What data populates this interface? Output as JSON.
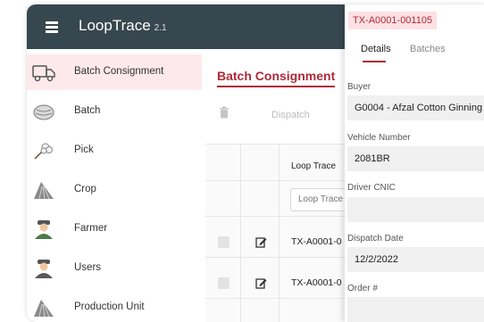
{
  "header": {
    "app_title": "LoopTrace",
    "version": "2.1"
  },
  "sidebar": {
    "items": [
      {
        "label": "Batch Consignment",
        "icon": "truck-icon"
      },
      {
        "label": "Batch",
        "icon": "cotton-bale-icon"
      },
      {
        "label": "Pick",
        "icon": "cotton-flower-icon"
      },
      {
        "label": "Crop",
        "icon": "crop-field-icon"
      },
      {
        "label": "Farmer",
        "icon": "farmer-icon"
      },
      {
        "label": "Users",
        "icon": "user-icon"
      },
      {
        "label": "Production Unit",
        "icon": "production-unit-icon"
      }
    ]
  },
  "main": {
    "title": "Batch Consignment",
    "dispatch_label": "Dispatch",
    "table": {
      "column_header": "Loop Trace",
      "filter_placeholder": "Loop Trace",
      "rows": [
        {
          "id": "TX-A0001-0"
        },
        {
          "id": "TX-A0001-0"
        }
      ]
    }
  },
  "panel": {
    "record_id": "TX-A0001-001105",
    "tabs": [
      {
        "label": "Details"
      },
      {
        "label": "Batches"
      }
    ],
    "fields": {
      "buyer_label": "Buyer",
      "buyer_value": "G0004 - Afzal Cotton Ginning",
      "vehicle_label": "Vehicle Number",
      "vehicle_value": "2081BR",
      "cnic_label": "Driver CNIC",
      "cnic_value": "",
      "date_label": "Dispatch Date",
      "date_value": "12/2/2022",
      "order_label": "Order #",
      "order_value": ""
    }
  },
  "colors": {
    "accent": "#b02a37",
    "topbar": "#37474f",
    "active_bg": "#fde9eb"
  }
}
